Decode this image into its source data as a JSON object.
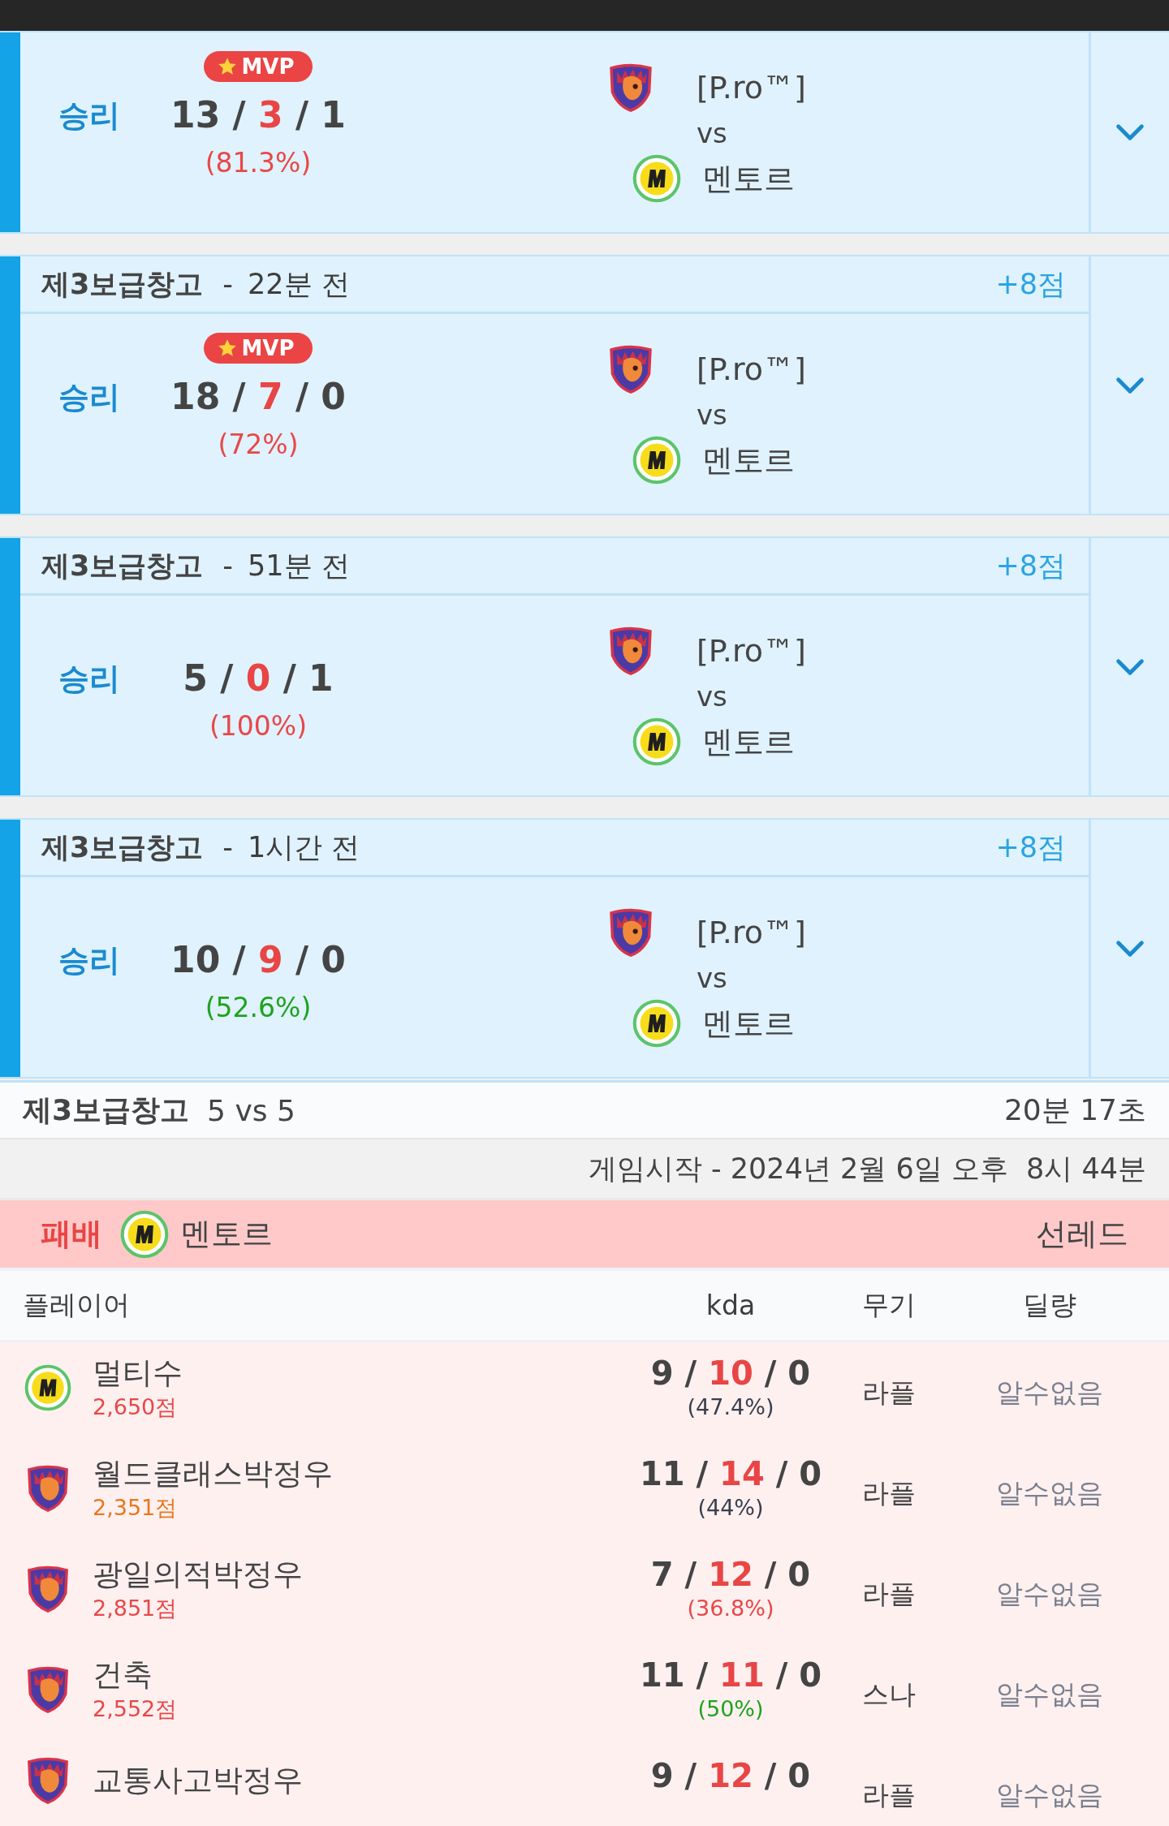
{
  "matches": [
    {
      "result": {
        "text": "승리",
        "kind": "win"
      },
      "mvp": true,
      "mvp_label": "MVP",
      "kda": [
        "13",
        "/",
        "3",
        "/",
        "1"
      ],
      "rate": {
        "text": "(81.3%)",
        "color": "#e84848"
      },
      "team": {
        "kind": "shield",
        "name": "[P.ro™]"
      },
      "versus": "vs",
      "opponent": {
        "kind": "m",
        "name": "멘토르"
      }
    },
    {
      "header": {
        "map": "제3보급창고",
        "separator": "-",
        "time": "22분 전",
        "points": "+8점"
      },
      "result": {
        "text": "승리",
        "kind": "win"
      },
      "mvp": true,
      "mvp_label": "MVP",
      "kda": [
        "18",
        "/",
        "7",
        "/",
        "0"
      ],
      "rate": {
        "text": "(72%)",
        "color": "#e84848"
      },
      "team": {
        "kind": "shield",
        "name": "[P.ro™]"
      },
      "versus": "vs",
      "opponent": {
        "kind": "m",
        "name": "멘토르"
      }
    },
    {
      "header": {
        "map": "제3보급창고",
        "separator": "-",
        "time": "51분 전",
        "points": "+8점"
      },
      "result": {
        "text": "승리",
        "kind": "win"
      },
      "mvp": false,
      "kda": [
        "5",
        "/",
        "0",
        "/",
        "1"
      ],
      "rate": {
        "text": "(100%)",
        "color": "#e84848"
      },
      "team": {
        "kind": "shield",
        "name": "[P.ro™]"
      },
      "versus": "vs",
      "opponent": {
        "kind": "m",
        "name": "멘토르"
      }
    },
    {
      "header": {
        "map": "제3보급창고",
        "separator": "-",
        "time": "1시간 전",
        "points": "+8점"
      },
      "result": {
        "text": "승리",
        "kind": "win"
      },
      "mvp": false,
      "kda": [
        "10",
        "/",
        "9",
        "/",
        "0"
      ],
      "rate": {
        "text": "(52.6%)",
        "color": "#1fa31f"
      },
      "team": {
        "kind": "shield",
        "name": "[P.ro™]"
      },
      "versus": "vs",
      "opponent": {
        "kind": "m",
        "name": "멘토르"
      }
    }
  ],
  "match_detail": {
    "map": "제3보급창고",
    "mode": "5 vs 5",
    "duration": "20분 17초",
    "start_time": "게임시작 - 2024년 2월 6일 오후  8시 44분",
    "team": {
      "result": {
        "text": "패배",
        "kind": "lose"
      },
      "kind": "m",
      "name": "멘토르",
      "side": "선레드"
    },
    "columns": [
      "플레이어",
      "kda",
      "무기",
      "딜량"
    ],
    "players": [
      {
        "kind": "m",
        "name": "멀티수",
        "score": {
          "text": "2,650점",
          "color": "#e84848"
        },
        "kda": [
          "9",
          "/",
          "10",
          "/",
          "0"
        ],
        "rate": {
          "text": "(47.4%)",
          "color": "#3a3f4c"
        },
        "weapon": "라플",
        "damage": "알수없음"
      },
      {
        "kind": "shield",
        "name": "월드클래스박정우",
        "score": {
          "text": "2,351점",
          "color": "#e8781e"
        },
        "kda": [
          "11",
          "/",
          "14",
          "/",
          "0"
        ],
        "rate": {
          "text": "(44%)",
          "color": "#3a3f4c"
        },
        "weapon": "라플",
        "damage": "알수없음"
      },
      {
        "kind": "shield",
        "name": "광일의적박정우",
        "score": {
          "text": "2,851점",
          "color": "#e84848"
        },
        "kda": [
          "7",
          "/",
          "12",
          "/",
          "0"
        ],
        "rate": {
          "text": "(36.8%)",
          "color": "#e84848"
        },
        "weapon": "라플",
        "damage": "알수없음"
      },
      {
        "kind": "shield",
        "name": "건축",
        "score": {
          "text": "2,552점",
          "color": "#e84848"
        },
        "kda": [
          "11",
          "/",
          "11",
          "/",
          "0"
        ],
        "rate": {
          "text": "(50%)",
          "color": "#1fa31f"
        },
        "weapon": "스나",
        "damage": "알수없음"
      },
      {
        "kind": "shield",
        "name": "교통사고박정우",
        "kda": [
          "9",
          "/",
          "12",
          "/",
          "0"
        ],
        "weapon": "라플",
        "damage": "알수없음"
      }
    ]
  }
}
